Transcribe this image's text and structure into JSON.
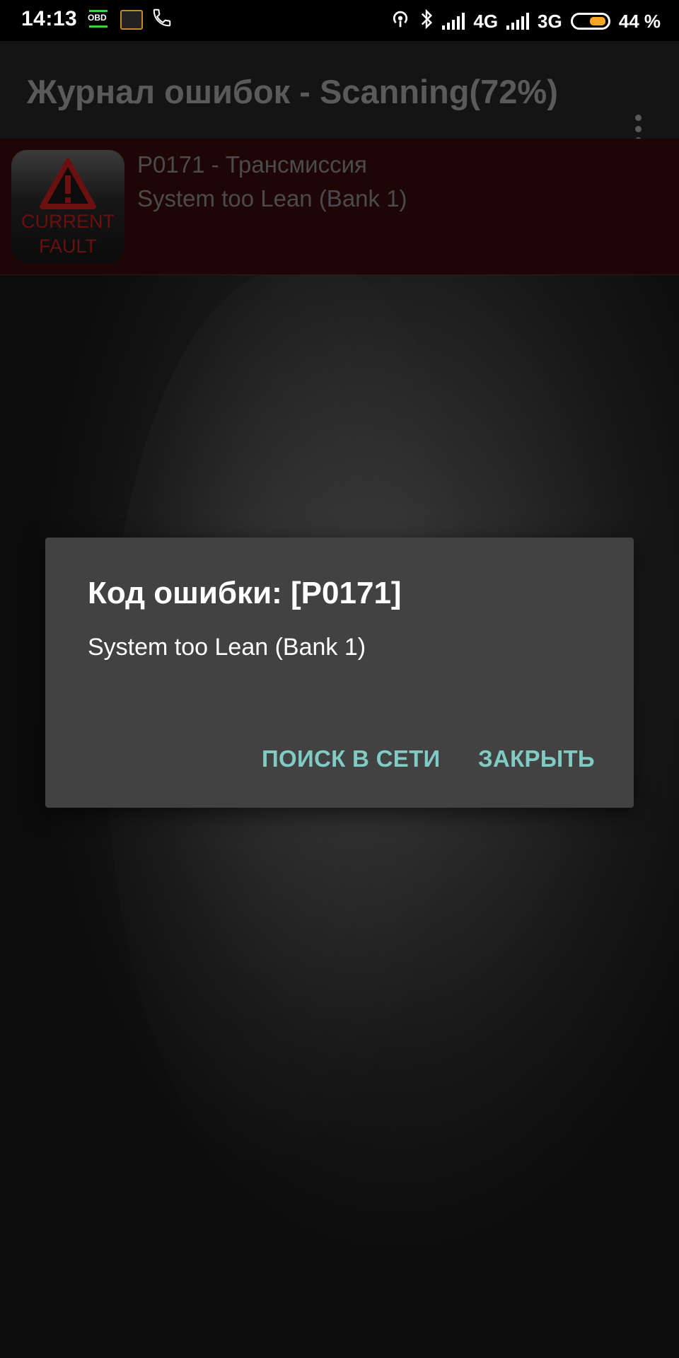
{
  "status_bar": {
    "time": "14:13",
    "obd_label": "OBD",
    "network_4g": "4G",
    "network_3g": "3G",
    "battery_percent": "44 %",
    "battery_level": 0.44,
    "icons": [
      "obd-transfer-icon",
      "car-app-icon",
      "phone-call-icon",
      "hotspot-icon",
      "bluetooth-icon",
      "signal-icon",
      "battery-icon"
    ]
  },
  "app_bar": {
    "title": "Журнал ошибок - Scanning(72%)",
    "overflow_icon": "more-vert-icon"
  },
  "fault_list": [
    {
      "icon_line1": "CURRENT",
      "icon_line2": "FAULT",
      "title": "P0171 - Трансмиссия",
      "description": "System too Lean (Bank 1)"
    }
  ],
  "dialog": {
    "title": "Код ошибки: [P0171]",
    "message": "System too Lean (Bank 1)",
    "search_button": "ПОИСК В СЕТИ",
    "close_button": "ЗАКРЫТЬ"
  },
  "colors": {
    "dialog_bg": "#424242",
    "button_text": "#80cbc4",
    "fault_row_bg": "#1f0606",
    "battery_fill": "#f5a623"
  }
}
